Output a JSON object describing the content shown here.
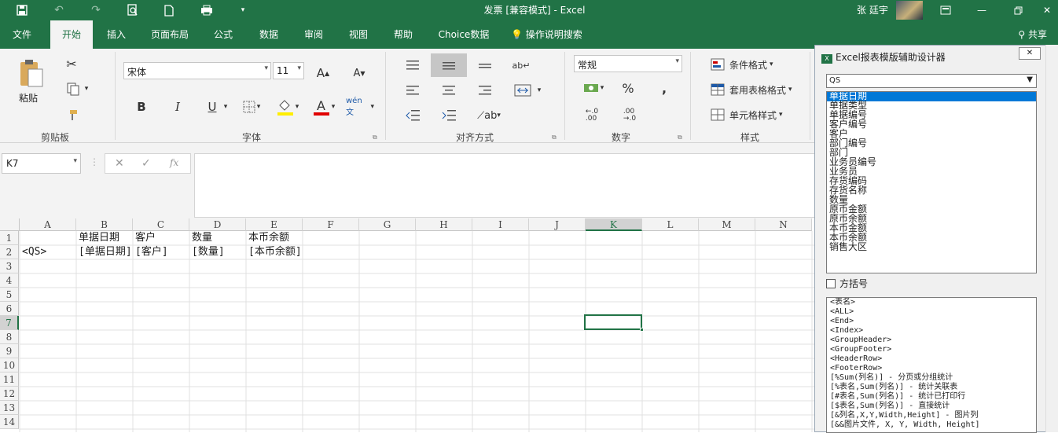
{
  "window": {
    "title": "发票  [兼容模式]  -  Excel",
    "user": "张 廷宇"
  },
  "tabs": [
    "文件",
    "开始",
    "插入",
    "页面布局",
    "公式",
    "数据",
    "审阅",
    "视图",
    "帮助",
    "Choice数据",
    "操作说明搜索"
  ],
  "share": "共享",
  "ribbon": {
    "paste": "粘贴",
    "clipboard": "剪贴板",
    "font_name": "宋体",
    "font_size": "11",
    "font": "字体",
    "alignment": "对齐方式",
    "number_format": "常规",
    "number": "数字",
    "cond_format": "条件格式",
    "table_format": "套用表格格式",
    "cell_style": "单元格样式",
    "styles": "样式",
    "bold": "B",
    "italic": "I",
    "underline": "U",
    "percent": "%",
    "comma": ","
  },
  "namebox": "K7",
  "columns": [
    "A",
    "B",
    "C",
    "D",
    "E",
    "F",
    "G",
    "H",
    "I",
    "J",
    "K",
    "L",
    "M",
    "N"
  ],
  "rows": [
    "1",
    "2",
    "3",
    "4",
    "5",
    "6",
    "7",
    "8",
    "9",
    "10",
    "11",
    "12",
    "13",
    "14"
  ],
  "cells": {
    "B1": "单据日期",
    "C1": "客户",
    "D1": "数量",
    "E1": "本币余额",
    "A2": "<QS>",
    "B2": "[单据日期]",
    "C2": "[客户]",
    "D2": "[数量]",
    "E2": "[本币余额]"
  },
  "panel": {
    "title": "Excel报表模版辅助设计器",
    "dataset": "QS",
    "fields": [
      "单据日期",
      "单据类型",
      "单据编号",
      "客户编号",
      "客户",
      "部门编号",
      "部门",
      "业务员编号",
      "业务员",
      "存货编码",
      "存货名称",
      "数量",
      "原币金额",
      "原币余额",
      "本币金额",
      "本币余额",
      "销售大区"
    ],
    "bracket_label": "方括号",
    "templates": [
      "<表名>",
      "<ALL>",
      "<End>",
      "<Index>",
      "<GroupHeader>",
      "<GroupFooter>",
      "<HeaderRow>",
      "<FooterRow>",
      "[%Sum(列名)] - 分页或分组统计",
      "[%表名,Sum(列名)] - 统计关联表",
      "[#表名,Sum(列名)] - 统计已打印行",
      "[$表名,Sum(列名)] - 直接统计",
      "[&列名,X,Y,Width,Height] - 图片列",
      "[&&图片文件, X, Y, Width, Height]"
    ]
  },
  "colors": {
    "accent": "#217346",
    "selection": "#0078d7"
  }
}
